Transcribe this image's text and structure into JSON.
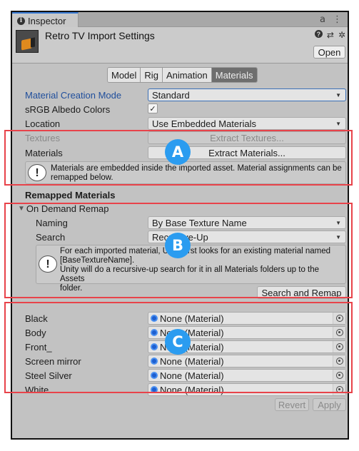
{
  "window": {
    "tab_label": "Inspector",
    "tab_icon": "info-icon",
    "tab_actions": [
      "lock-icon",
      "more-options-icon"
    ]
  },
  "header": {
    "title": "Retro TV Import Settings",
    "icons": [
      "help-icon",
      "presets-icon",
      "settings-gear-icon"
    ],
    "open_label": "Open"
  },
  "toolbar": {
    "tabs": [
      {
        "label": "Model",
        "active": false
      },
      {
        "label": "Rig",
        "active": false
      },
      {
        "label": "Animation",
        "active": false
      },
      {
        "label": "Materials",
        "active": true
      }
    ]
  },
  "settings": {
    "material_creation_mode": {
      "label": "Material Creation Mode",
      "value": "Standard"
    },
    "srgb_albedo": {
      "label": "sRGB Albedo Colors",
      "checked": true,
      "check_glyph": "✓"
    },
    "location": {
      "label": "Location",
      "value": "Use Embedded Materials"
    },
    "textures": {
      "label": "Textures",
      "button": "Extract Textures..."
    },
    "materials": {
      "label": "Materials",
      "button": "Extract Materials..."
    },
    "embedded_help": "Materials are embedded inside the imported asset. Material assignments can be remapped below."
  },
  "remapped": {
    "heading": "Remapped Materials",
    "foldout": {
      "label": "On Demand Remap",
      "glyph": "▼"
    },
    "naming": {
      "label": "Naming",
      "value": "By Base Texture Name"
    },
    "search": {
      "label": "Search",
      "value": "Recursive-Up"
    },
    "help_lines": [
      "For each imported material, Unity first looks for an existing material named",
      "[BaseTextureName].",
      "Unity will do a recursive-up search for it in all Materials folders up to the Assets",
      "folder."
    ],
    "search_remap_label": "Search and Remap"
  },
  "material_slots": [
    {
      "name": "Black",
      "value": "None (Material)"
    },
    {
      "name": "Body",
      "value": "None (Material)"
    },
    {
      "name": "Front_",
      "value": "None (Material)"
    },
    {
      "name": "Screen mirror",
      "value": "None (Material)"
    },
    {
      "name": "Steel Silver",
      "value": "None (Material)"
    },
    {
      "name": "White",
      "value": "None (Material)"
    }
  ],
  "footer": {
    "revert_label": "Revert",
    "apply_label": "Apply"
  },
  "callouts": [
    {
      "letter": "A",
      "color": "#2b9cf0"
    },
    {
      "letter": "B",
      "color": "#2b9cf0"
    },
    {
      "letter": "C",
      "color": "#2b9cf0"
    }
  ],
  "colors": {
    "callout_border": "#e8434a",
    "active_tab": "#6e6e6e",
    "label_highlight": "#1f4e9c"
  }
}
